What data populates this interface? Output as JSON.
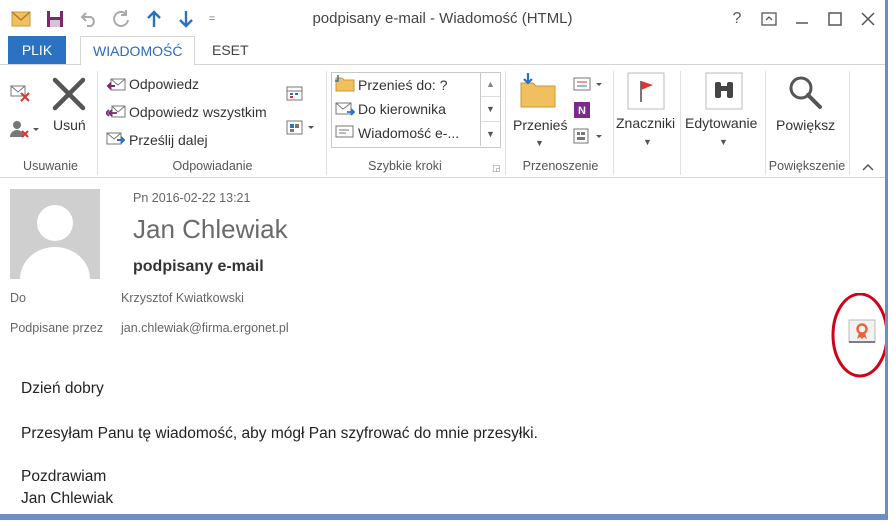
{
  "window": {
    "title": "podpisany e-mail - Wiadomość (HTML)",
    "help": "?",
    "qat_more": "="
  },
  "tabs": [
    {
      "label": "PLIK"
    },
    {
      "label": "WIADOMOŚĆ"
    },
    {
      "label": "ESET"
    }
  ],
  "ribbon": {
    "groups": {
      "usuwanie": "Usuwanie",
      "odpowiadanie": "Odpowiadanie",
      "szybkie_kroki": "Szybkie kroki",
      "przenoszenie": "Przenoszenie",
      "powiekszenie": "Powiększenie"
    },
    "delete_label": "Usuń",
    "reply": "Odpowiedz",
    "reply_all": "Odpowiedz wszystkim",
    "forward": "Prześlij dalej",
    "quick_steps": [
      "Przenieś do: ?",
      "Do kierownika",
      "Wiadomość e-..."
    ],
    "move": "Przenieś",
    "tags": "Znaczniki",
    "editing": "Edytowanie",
    "zoom": "Powiększ"
  },
  "message": {
    "date": "Pn 2016-02-22 13:21",
    "sender": "Jan Chlewiak",
    "subject": "podpisany e-mail",
    "to_label": "Do",
    "to_value": "Krzysztof Kwiatkowski",
    "signed_label": "Podpisane przez",
    "signed_value": "jan.chlewiak@firma.ergonet.pl",
    "body": [
      "Dzień dobry",
      "Przesyłam Panu tę wiadomość, aby mógł Pan szyfrować do mnie przesyłki.",
      "Pozdrawiam",
      "Jan Chlewiak"
    ]
  },
  "colors": {
    "accent": "#2b72c2",
    "highlight_circle": "#d0021b",
    "signature_badge": "#e8623a"
  }
}
